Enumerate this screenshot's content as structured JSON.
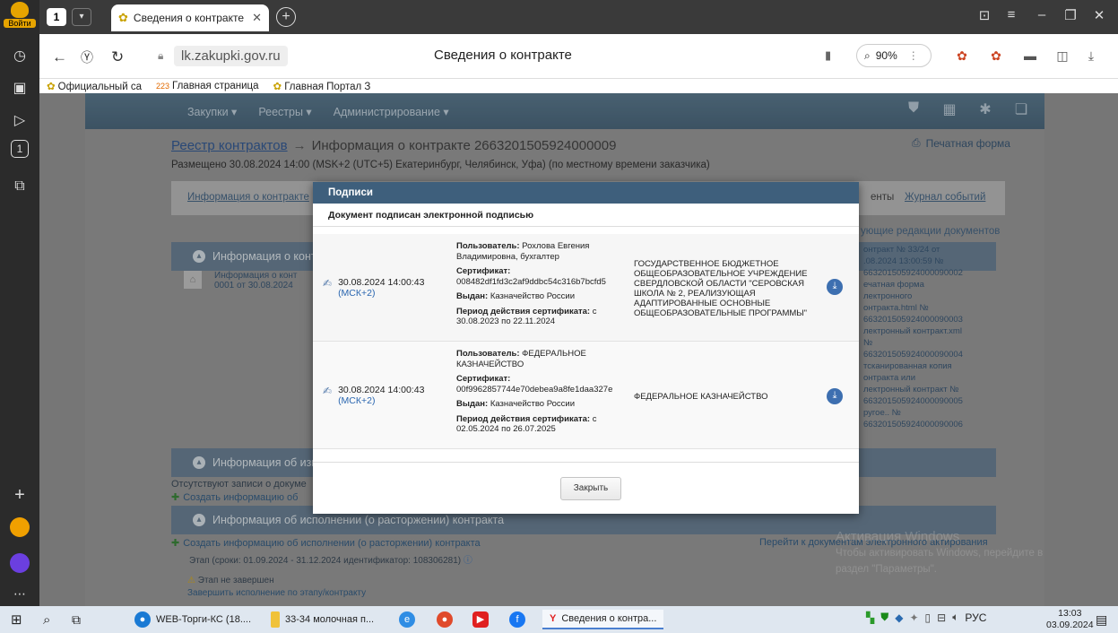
{
  "sidebar": {
    "login_label": "Войти",
    "counter": "1"
  },
  "browser": {
    "tab_counter": "1",
    "tab_title": "Сведения о контракте",
    "url_host": "lk.zakupki.gov.ru",
    "page_title": "Сведения о контракте",
    "zoom": "90%",
    "bookmarks": [
      {
        "label": "Официальный са"
      },
      {
        "badge": "223",
        "label": "Главная страница"
      },
      {
        "label": "Главная Портал З"
      }
    ]
  },
  "topnav": {
    "items": [
      "Закупки ▾",
      "Реестры ▾",
      "Администрирование ▾"
    ]
  },
  "header": {
    "breadcrumb_link": "Реестр контрактов",
    "breadcrumb_current": "Информация о контракте 2663201505924000009",
    "print_form": "Печатная форма",
    "posted": "Размещено 30.08.2024 14:00 (MSK+2 (UTC+5) Екатеринбург, Челябинск, Уфа) (по местному времени заказчика)"
  },
  "tabs": {
    "info": "Информация о контракте",
    "docs_suffix": "енты",
    "journal": "Журнал событий"
  },
  "sub_link": "ующие редакции документов",
  "sections": {
    "info_head": "Информация о контр",
    "changes_head": "Информация об изме",
    "exec_head": "Информация об исполнении (о расторжении) контракта"
  },
  "doc_row": {
    "line1": "Информация о конт",
    "line2": "0001 от 30.08.2024"
  },
  "right_list": [
    "онтракт № 33/24 от",
    ".08.2024 13:00:59 №",
    "663201505924000090002",
    "ечатная форма",
    "лектронного",
    "онтракта.html №",
    "663201505924000090003",
    "лектронный контракт.xml",
    "№",
    "663201505924000090004",
    "тсканированная копия",
    "онтракта или",
    "лектронный контракт №",
    "663201505924000090005",
    "ругое.. №",
    "663201505924000090006"
  ],
  "bg": {
    "no_records": "Отсутствуют записи о докуме",
    "create_info": "Создать информацию об",
    "create_exec": "Создать информацию об исполнении (о расторжении) контракта",
    "stage": "Этап (сроки: 01.09.2024 - 31.12.2024 идентификатор: 108306281)",
    "stage_not_done": "Этап не завершен",
    "finish_stage": "Завершить исполнение по этапу/контракту",
    "goto_docs": "Перейти к документам электронного актирования"
  },
  "watermark": {
    "title": "Активация Windows",
    "line1": "Чтобы активировать Windows, перейдите в",
    "line2": "раздел \"Параметры\"."
  },
  "modal": {
    "title": "Подписи",
    "subtitle": "Документ подписан электронной подписью",
    "user_label": "Пользователь:",
    "cert_label": "Сертификат:",
    "issued_label": "Выдан:",
    "period_label": "Период действия сертификата:",
    "signatures": [
      {
        "date": "30.08.2024 14:00:43",
        "tz": "(МСК+2)",
        "user": "Рохлова Евгения Владимировна, бухгалтер",
        "cert": "008482df1fd3c2af9ddbc54c316b7bcfd5",
        "issued": "Казначейство России",
        "period": "с 30.08.2023 по 22.11.2024",
        "org": "ГОСУДАРСТВЕННОЕ БЮДЖЕТНОЕ ОБЩЕОБРАЗОВАТЕЛЬНОЕ УЧРЕЖДЕНИЕ СВЕРДЛОВСКОЙ ОБЛАСТИ \"СЕРОВСКАЯ ШКОЛА № 2, РЕАЛИЗУЮЩАЯ АДАПТИРОВАННЫЕ ОСНОВНЫЕ ОБЩЕОБРАЗОВАТЕЛЬНЫЕ ПРОГРАММЫ\""
      },
      {
        "date": "30.08.2024 14:00:43",
        "tz": "(МСК+2)",
        "user": "ФЕДЕРАЛЬНОЕ КАЗНАЧЕЙСТВО",
        "cert": "00f9962857744e70debea9a8fe1daa327e",
        "issued": "Казначейство России",
        "period": "с 02.05.2024 по 26.07.2025",
        "org": "ФЕДЕРАЛЬНОЕ КАЗНАЧЕЙСТВО"
      }
    ],
    "close_label": "Закрыть"
  },
  "taskbar": {
    "items": [
      "WEB-Торги-КС (18....",
      "33-34 молочная п...",
      "Сведения о контра..."
    ],
    "lang": "РУС",
    "time": "13:03",
    "date": "03.09.2024"
  }
}
